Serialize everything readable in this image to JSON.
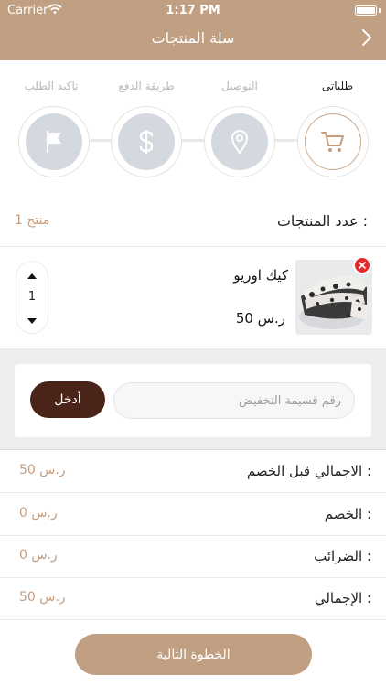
{
  "status_bar": {
    "carrier": "Carrier",
    "time": "1:17 PM"
  },
  "nav": {
    "title": "سلة المنتجات",
    "back_icon": "chevron-right-icon"
  },
  "steps": [
    {
      "label": "طلباتى",
      "icon": "cart-icon",
      "state": "active"
    },
    {
      "label": "التوصيل",
      "icon": "location-pin-icon",
      "state": "inactive"
    },
    {
      "label": "طريقة الدفع",
      "icon": "dollar-icon",
      "state": "inactive"
    },
    {
      "label": "تاكيد الطلب",
      "icon": "flag-icon",
      "state": "inactive"
    }
  ],
  "product_count": {
    "label": "عدد المنتجات :",
    "value": "1 منتج"
  },
  "product": {
    "name": "كيك اوريو",
    "price": "50 ر.س",
    "quantity": "1"
  },
  "coupon": {
    "placeholder": "رقم قسيمة التخفيض",
    "button_label": "أدخل"
  },
  "summary": [
    {
      "label": "الاجمالي قبل الخصم :",
      "value": "50 ر.س"
    },
    {
      "label": "الخصم :",
      "value": "0 ر.س"
    },
    {
      "label": "الضرائب :",
      "value": "0 ر.س"
    },
    {
      "label": "الإجمالي :",
      "value": "50 ر.س"
    }
  ],
  "next_button": {
    "label": "الخطوة التالية"
  },
  "colors": {
    "brand": "#c19f82",
    "accent_text": "#c59e80",
    "dark_button": "#4a2418",
    "inactive_step": "#d3d9df",
    "remove": "#e32b2b"
  }
}
